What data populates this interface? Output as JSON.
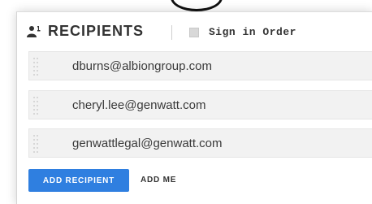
{
  "recipients_panel": {
    "title": "RECIPIENTS",
    "title_icon": "people-icon",
    "sign_in_order": {
      "label": "Sign in Order",
      "checked": false
    },
    "recipients": [
      {
        "email": "dburns@albiongroup.com"
      },
      {
        "email": "cheryl.lee@genwatt.com"
      },
      {
        "email": "genwattlegal@genwatt.com"
      }
    ],
    "drag_handle_icon": "drag-handle-icon",
    "add_recipient_label": "ADD RECIPIENT",
    "add_me_label": "ADD ME"
  },
  "colors": {
    "primary_button": "#2f7fe0",
    "row_background": "#f2f2f2",
    "text": "#333333"
  }
}
